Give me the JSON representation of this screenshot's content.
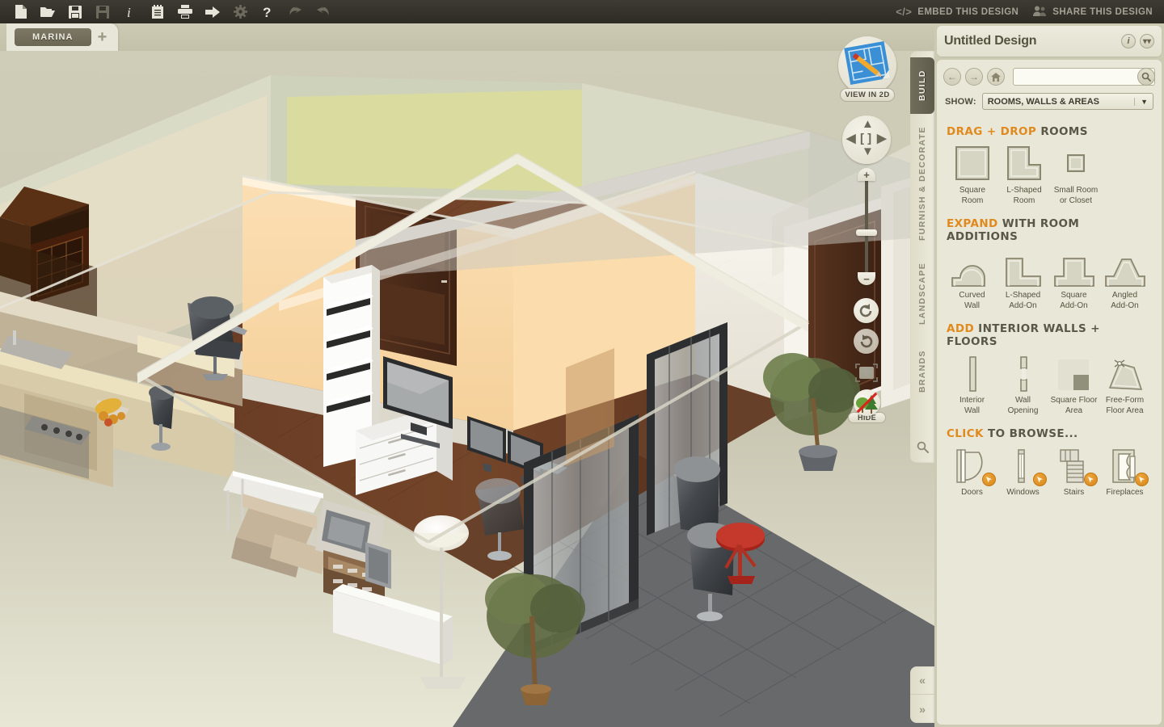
{
  "toolbar": {
    "buttons": [
      {
        "name": "new-document-icon",
        "label": "New",
        "dim": false
      },
      {
        "name": "open-folder-icon",
        "label": "Open",
        "dim": false
      },
      {
        "name": "save-icon",
        "label": "Save",
        "dim": false
      },
      {
        "name": "save-as-icon",
        "label": "Save As",
        "dim": true
      },
      {
        "name": "info-icon",
        "label": "Info",
        "dim": false
      },
      {
        "name": "notes-icon",
        "label": "Notes",
        "dim": false
      },
      {
        "name": "print-icon",
        "label": "Print",
        "dim": false
      },
      {
        "name": "export-icon",
        "label": "Export",
        "dim": false
      },
      {
        "name": "settings-gear-icon",
        "label": "Settings",
        "dim": true
      },
      {
        "name": "help-question-icon",
        "label": "Help",
        "dim": false
      },
      {
        "name": "undo-arrow-icon",
        "label": "Undo",
        "dim": true
      },
      {
        "name": "redo-arrow-icon",
        "label": "Redo",
        "dim": true
      }
    ],
    "embed_label": "EMBED THIS DESIGN",
    "embed_icon": "</>",
    "share_label": "SHARE THIS DESIGN",
    "share_icon": "people-icon"
  },
  "tabstrip": {
    "document_tab": "MARINA",
    "add_tab": "+"
  },
  "viewport": {
    "view_2d_label": "VIEW IN 2D",
    "dpad": {
      "up": "▲",
      "down": "▼",
      "left": "◀",
      "right": "▶",
      "center": "[ ]"
    },
    "zoom_in": "+",
    "zoom_out": "−",
    "rotate_left_icon": "rotate-left-icon",
    "rotate_right_icon": "rotate-right-icon",
    "crop_icon": "crop-frame-icon",
    "hide_label": "HIDE",
    "collapse_left": "«",
    "collapse_right": "»"
  },
  "rail": {
    "tabs": [
      {
        "label": "BUILD",
        "active": true
      },
      {
        "label": "FURNISH & DECORATE",
        "active": false
      },
      {
        "label": "LANDSCAPE",
        "active": false
      },
      {
        "label": "BRANDS",
        "active": false
      }
    ],
    "search_icon": "search-icon"
  },
  "panel": {
    "title": "Untitled Design",
    "info_icon": "i",
    "collapse_icon": "»",
    "nav": {
      "back": "←",
      "forward": "→",
      "home": "home-icon",
      "search_icon": "search-icon"
    },
    "search_value": "",
    "search_placeholder": "",
    "show_label": "SHOW:",
    "show_value": "ROOMS, WALLS & AREAS",
    "show_caret": "▼",
    "sections": [
      {
        "heading_highlight": "DRAG + DROP",
        "heading_rest": " ROOMS",
        "items": [
          {
            "icon": "square-room-icon",
            "caption": "Square\nRoom"
          },
          {
            "icon": "l-shaped-room-icon",
            "caption": "L-Shaped\nRoom"
          },
          {
            "icon": "small-room-or-closet-icon",
            "caption": "Small Room\nor Closet"
          }
        ]
      },
      {
        "heading_highlight": "EXPAND",
        "heading_rest": " WITH ROOM ADDITIONS",
        "items": [
          {
            "icon": "curved-wall-icon",
            "caption": "Curved\nWall"
          },
          {
            "icon": "l-shaped-add-on-icon",
            "caption": "L-Shaped\nAdd-On"
          },
          {
            "icon": "square-add-on-icon",
            "caption": "Square\nAdd-On"
          },
          {
            "icon": "angled-add-on-icon",
            "caption": "Angled\nAdd-On"
          }
        ]
      },
      {
        "heading_highlight": "ADD",
        "heading_rest": " INTERIOR WALLS + FLOORS",
        "items": [
          {
            "icon": "interior-wall-icon",
            "caption": "Interior\nWall"
          },
          {
            "icon": "wall-opening-icon",
            "caption": "Wall\nOpening"
          },
          {
            "icon": "square-floor-area-icon",
            "caption": "Square Floor\nArea"
          },
          {
            "icon": "free-form-floor-area-icon",
            "caption": "Free-Form\nFloor Area"
          }
        ]
      },
      {
        "heading_highlight": "CLICK",
        "heading_rest": " TO BROWSE...",
        "items": [
          {
            "icon": "doors-icon",
            "caption": "Doors",
            "badge": true
          },
          {
            "icon": "windows-icon",
            "caption": "Windows",
            "badge": true
          },
          {
            "icon": "stairs-icon",
            "caption": "Stairs",
            "badge": true
          },
          {
            "icon": "fireplaces-icon",
            "caption": "Fireplaces",
            "badge": true
          }
        ]
      }
    ]
  },
  "colors": {
    "accent_orange": "#e08a1e",
    "toolbar_dark": "#36332c",
    "panel_bg": "#e9e7d8",
    "rail_active": "#655f4f"
  }
}
